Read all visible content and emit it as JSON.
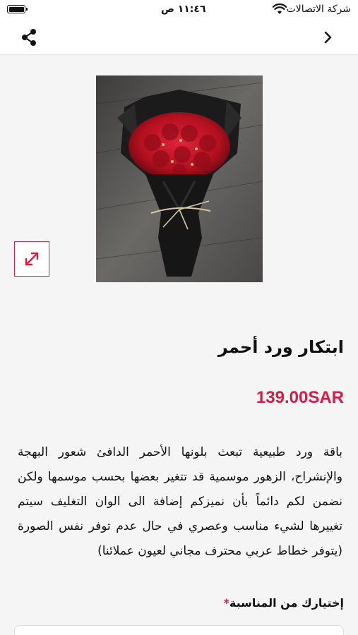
{
  "status_bar": {
    "carrier": "شركة الاتصالات",
    "time": "١١:٤٦ ص"
  },
  "product": {
    "title": "ابتكار ورد أحمر",
    "price": "139.00SAR",
    "description": "باقة ورد طبيعية تبعث بلونها الأحمر الدافئ شعور البهجة والإنشراح، الزهور موسمية قد تتغير بعضها بحسب موسمها ولكن نضمن لكم دائماً بأن نميزكم إضافة الى الوان التغليف سيتم تغييرها لشيء مناسب وعصري في حال عدم توفر نفس الصورة (يتوفر خطاط عربي محترف مجاني لعيون عملائنا)"
  },
  "form": {
    "occasion_label": "إختيارك من المناسبة",
    "required_mark": "*"
  },
  "icons": {
    "share": "share-icon",
    "back": "chevron-right-icon",
    "expand": "expand-icon"
  },
  "colors": {
    "accent": "#d81b47",
    "background": "#f5f5f5"
  }
}
